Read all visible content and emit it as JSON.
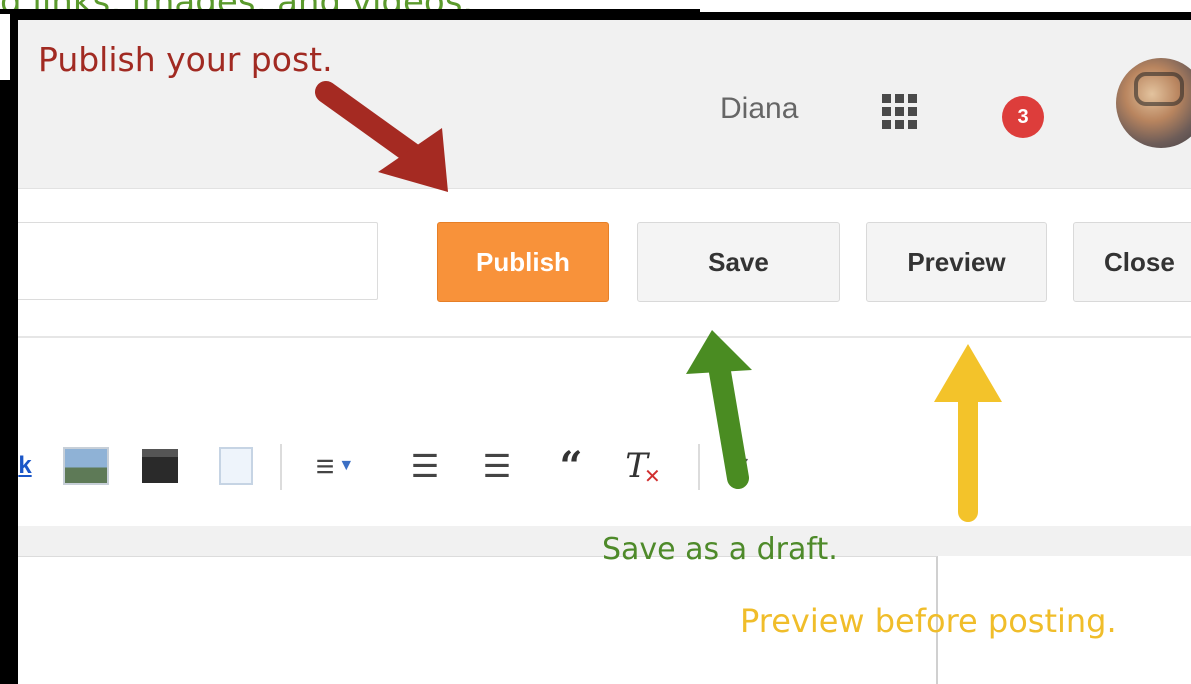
{
  "background": {
    "caption": "d links, images, and videos."
  },
  "header": {
    "user_name": "Diana",
    "notification_count": "3"
  },
  "actions": {
    "publish_label": "Publish",
    "save_label": "Save",
    "preview_label": "Preview",
    "close_label": "Close"
  },
  "toolbar": {
    "link_fragment": "k",
    "items": [
      "link",
      "insert-image",
      "insert-video",
      "insert-jump-break",
      "alignment",
      "numbered-list",
      "bulleted-list",
      "quote",
      "remove-formatting",
      "spell-check"
    ]
  },
  "annotations": {
    "publish_note": "Publish your post.",
    "save_note": "Save as a draft.",
    "preview_note": "Preview before posting.",
    "colors": {
      "publish_arrow": "#a52a22",
      "save_arrow": "#4a8c22",
      "preview_arrow": "#f3c32a"
    }
  },
  "colors": {
    "publish_button": "#f8923a",
    "badge": "#dd3d3b"
  }
}
